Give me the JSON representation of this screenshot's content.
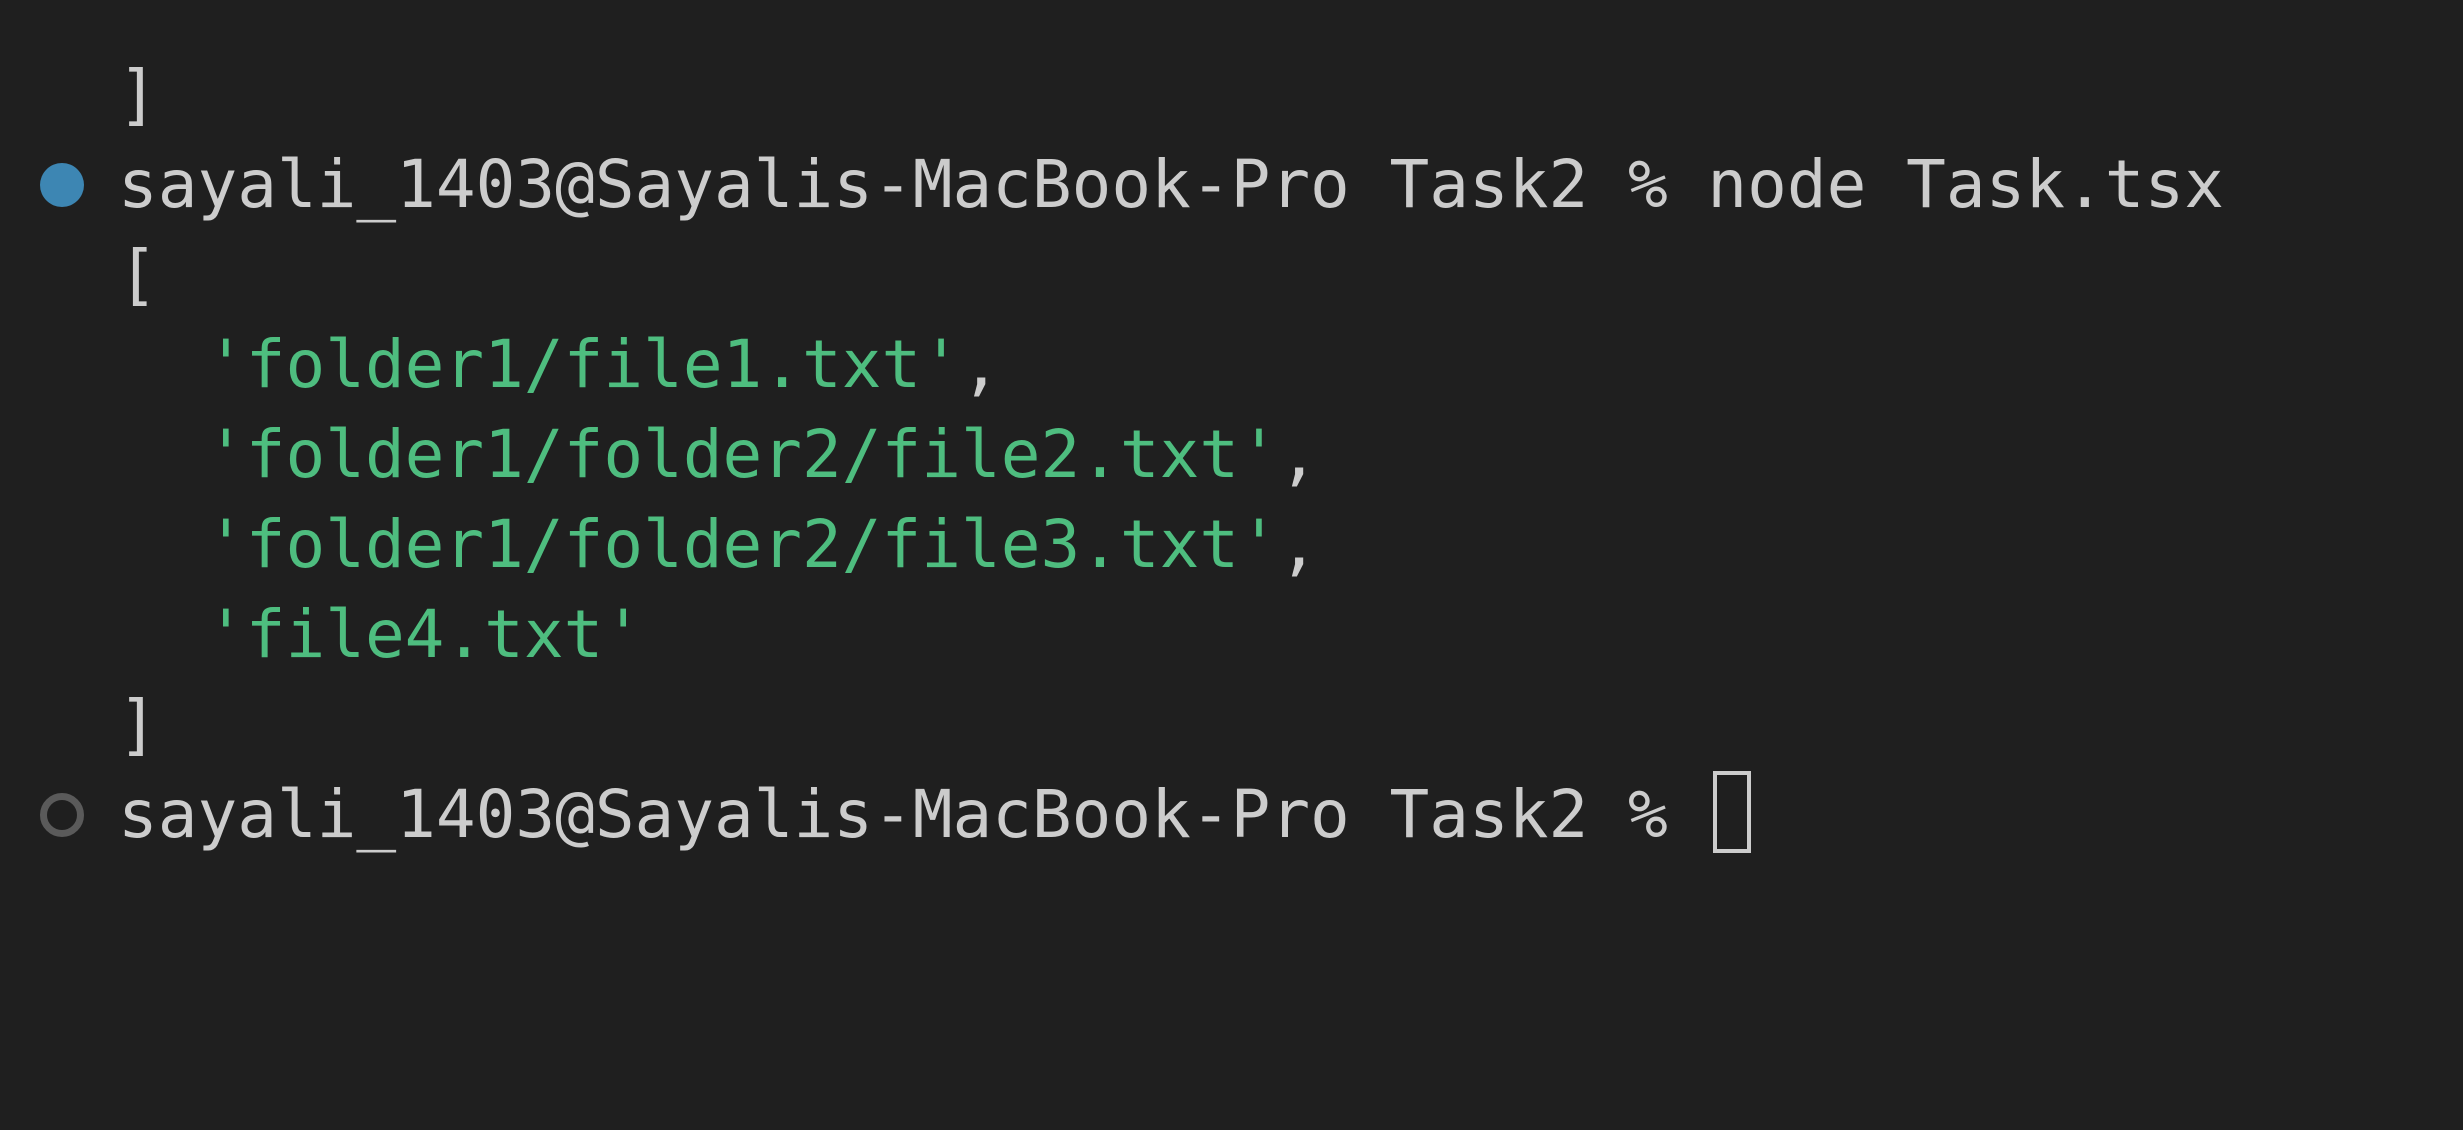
{
  "terminal": {
    "lines": {
      "prev_close_bracket": "]",
      "command": {
        "prompt": "sayali_1403@Sayalis-MacBook-Pro Task2 % ",
        "input": "node Task.tsx"
      },
      "open_bracket": "[",
      "items": [
        {
          "value": "'folder1/file1.txt'",
          "suffix": ","
        },
        {
          "value": "'folder1/folder2/file2.txt'",
          "suffix": ","
        },
        {
          "value": "'folder1/folder2/file3.txt'",
          "suffix": ","
        },
        {
          "value": "'file4.txt'",
          "suffix": ""
        }
      ],
      "close_bracket": "]",
      "current_prompt": "sayali_1403@Sayalis-MacBook-Pro Task2 % "
    },
    "colors": {
      "background": "#1f1f1f",
      "text": "#cccccc",
      "string": "#4ebd7f",
      "success_decoration": "#3d86b3",
      "pending_decoration": "#5a5a5a"
    },
    "icons": {
      "success_decoration": "filled-circle-icon",
      "pending_decoration": "hollow-circle-icon",
      "cursor": "block-cursor-icon"
    }
  }
}
